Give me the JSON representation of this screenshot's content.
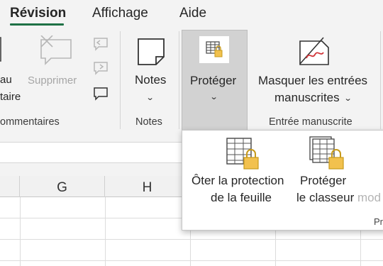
{
  "tabs": [
    {
      "label": "Révision",
      "active": true
    },
    {
      "label": "Affichage",
      "active": false
    },
    {
      "label": "Aide",
      "active": false
    }
  ],
  "ribbon": {
    "comments_group": {
      "partial_btn_line1": "au",
      "partial_btn_line2": "taire",
      "delete_label": "Supprimer",
      "group_label": "ommentaires"
    },
    "notes_group": {
      "notes_label": "Notes",
      "group_label": "Notes"
    },
    "protect_group": {
      "protect_label": "Protéger"
    },
    "ink_group": {
      "hide_ink_line1": "Masquer les entrées",
      "hide_ink_line2": "manuscrites",
      "group_label": "Entrée manuscrite"
    }
  },
  "grid": {
    "columns": [
      "G",
      "H"
    ]
  },
  "protect_menu": {
    "unprotect_sheet_line1": "Ôter la protection",
    "unprotect_sheet_line2": "de la feuille",
    "protect_workbook_line1": "Protéger",
    "protect_workbook_line2": "le classeur",
    "truncated_item": "mod",
    "group_label_partial": "Pr"
  },
  "colors": {
    "accent": "#1e7145",
    "lock": "#f2c14e",
    "ink_red": "#d13438"
  }
}
